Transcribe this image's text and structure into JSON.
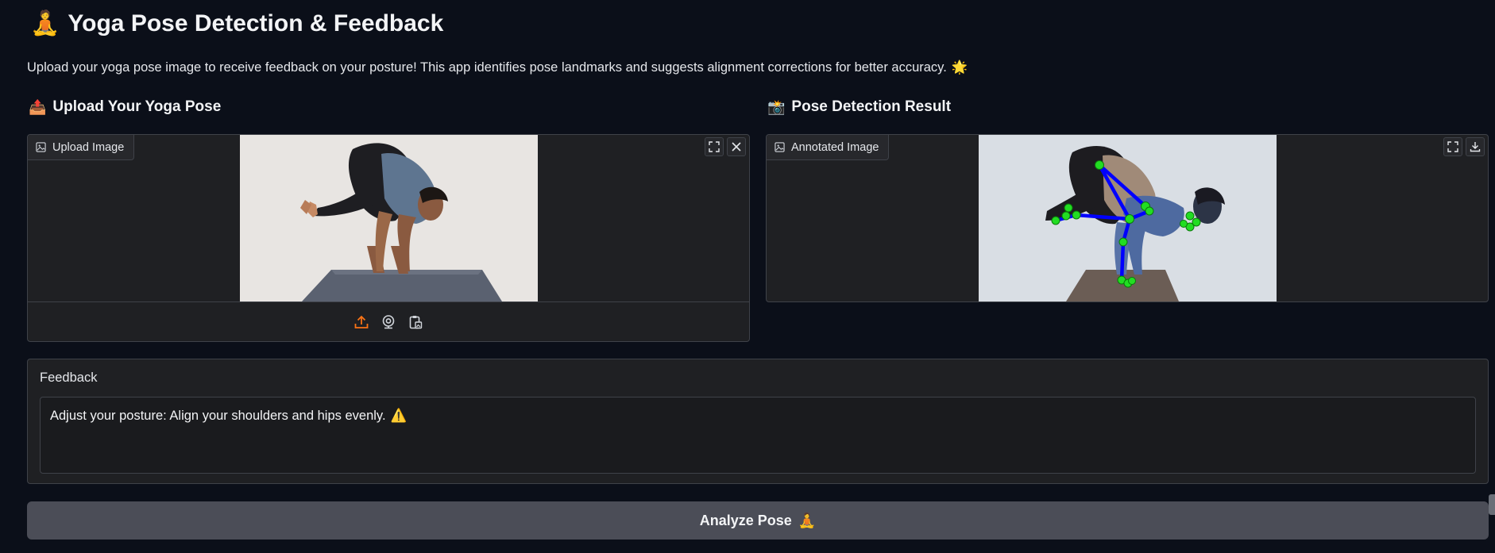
{
  "app": {
    "title_emoji": "🧘",
    "title": "Yoga Pose Detection & Feedback",
    "intro": "Upload your yoga pose image to receive feedback on your posture! This app identifies pose landmarks and suggests alignment corrections for better accuracy.",
    "intro_emoji": "🌟"
  },
  "upload_section": {
    "heading_emoji": "📤",
    "heading": "Upload Your Yoga Pose",
    "panel_label": "Upload Image",
    "icons": {
      "label": "image-icon",
      "fullscreen": "fullscreen-icon",
      "clear": "close-icon",
      "upload": "upload-icon",
      "webcam": "webcam-icon",
      "clipboard": "clipboard-icon"
    }
  },
  "result_section": {
    "heading_emoji": "📸",
    "heading": "Pose Detection Result",
    "panel_label": "Annotated Image",
    "icons": {
      "label": "image-icon",
      "fullscreen": "fullscreen-icon",
      "download": "download-icon"
    }
  },
  "feedback": {
    "label": "Feedback",
    "value": "Adjust your posture: Align your shoulders and hips evenly.",
    "value_emoji": "⚠️"
  },
  "action": {
    "label": "Analyze Pose",
    "emoji": "🧘"
  },
  "colors": {
    "background": "#0b0f19",
    "panel": "#1f2023",
    "border": "#3f4249",
    "accent_upload": "#f97316",
    "button": "#4b4d57",
    "landmark": "#22dd22",
    "skeleton": "#0000ff"
  }
}
